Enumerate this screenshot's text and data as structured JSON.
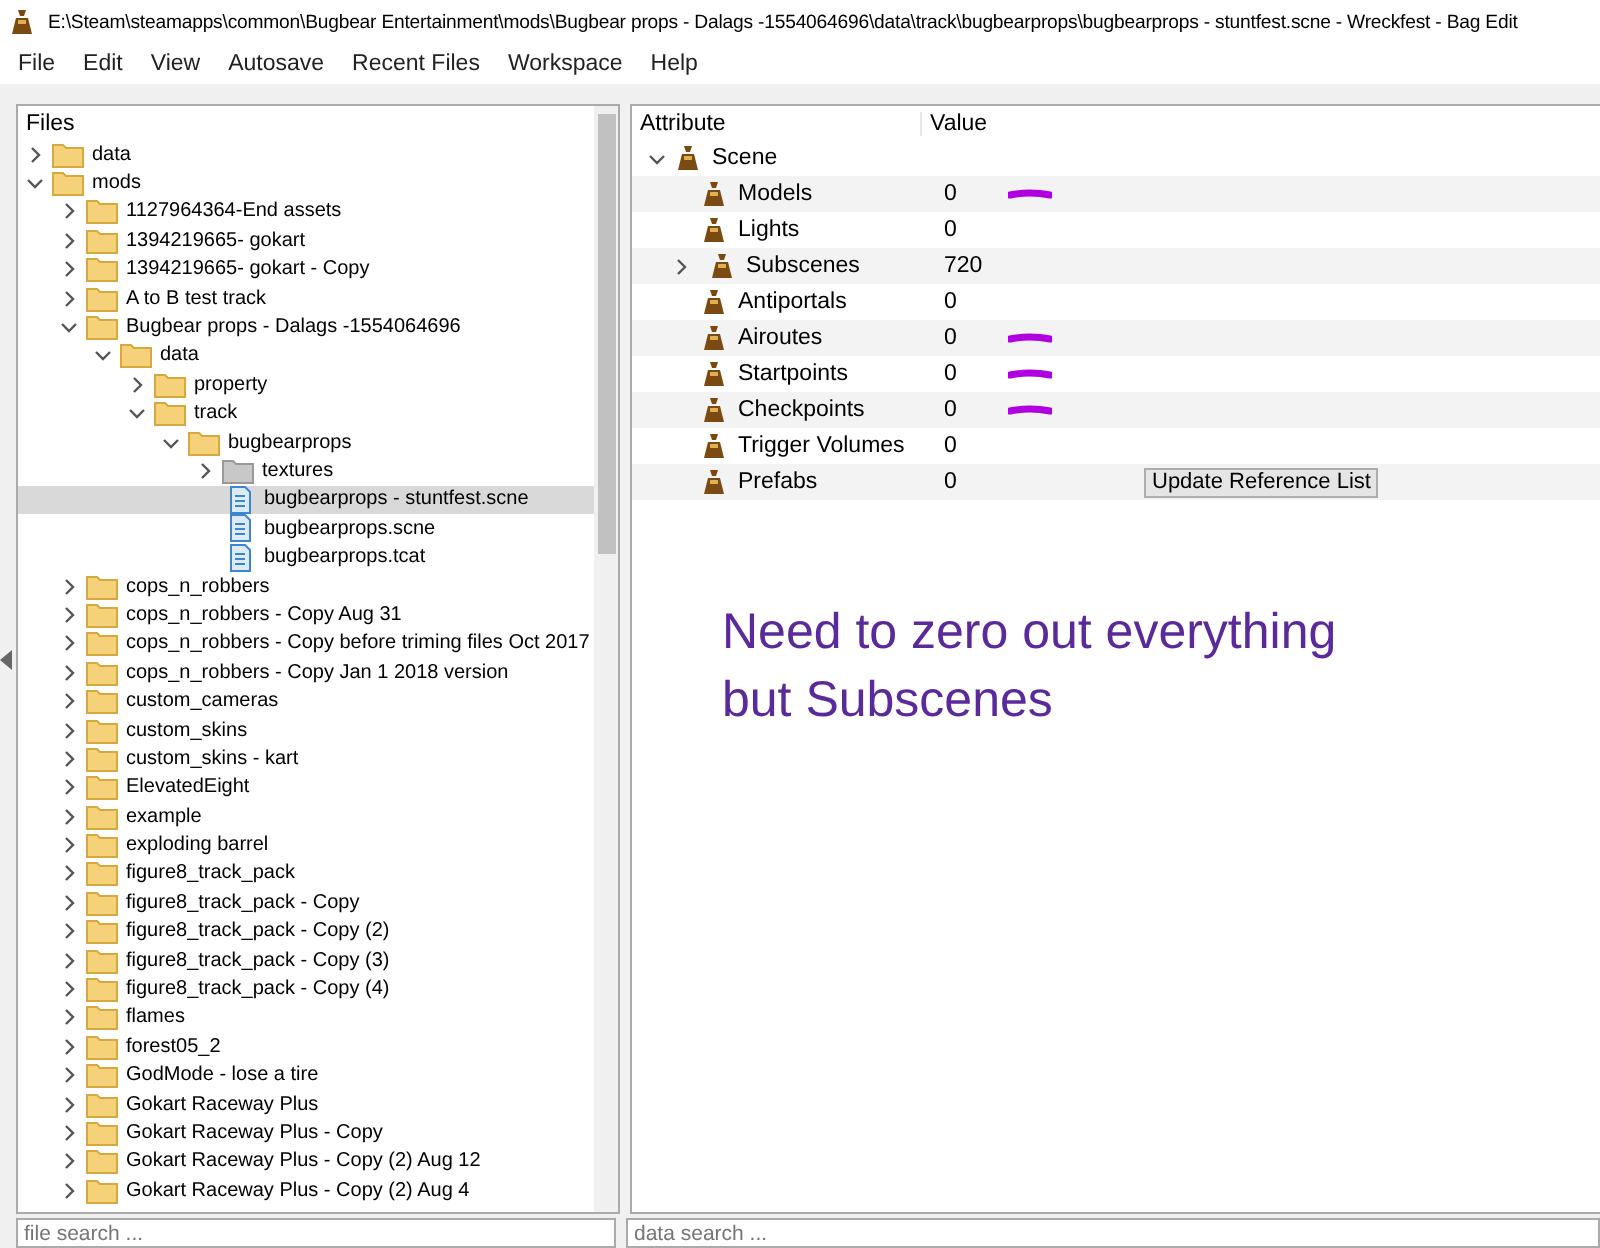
{
  "window": {
    "title": "E:\\Steam\\steamapps\\common\\Bugbear Entertainment\\mods\\Bugbear props - Dalags -1554064696\\data\\track\\bugbearprops\\bugbearprops - stuntfest.scne - Wreckfest - Bag Edit"
  },
  "menu": [
    "File",
    "Edit",
    "View",
    "Autosave",
    "Recent Files",
    "Workspace",
    "Help"
  ],
  "files": {
    "header": "Files",
    "search_placeholder": "file search ...",
    "tree": [
      {
        "name": "data",
        "kind": "folder",
        "expanded": false,
        "selected": false
      },
      {
        "name": "mods",
        "kind": "folder",
        "expanded": true,
        "selected": false,
        "children": [
          {
            "name": "1127964364-End assets",
            "kind": "folder",
            "expanded": false,
            "selected": false
          },
          {
            "name": "1394219665- gokart",
            "kind": "folder",
            "expanded": false,
            "selected": false
          },
          {
            "name": "1394219665- gokart - Copy",
            "kind": "folder",
            "expanded": false,
            "selected": false
          },
          {
            "name": "A to B test track",
            "kind": "folder",
            "expanded": false,
            "selected": false
          },
          {
            "name": "Bugbear props - Dalags -1554064696",
            "kind": "folder",
            "expanded": true,
            "selected": false,
            "children": [
              {
                "name": "data",
                "kind": "folder",
                "expanded": true,
                "selected": false,
                "children": [
                  {
                    "name": "property",
                    "kind": "folder",
                    "expanded": false,
                    "selected": false
                  },
                  {
                    "name": "track",
                    "kind": "folder",
                    "expanded": true,
                    "selected": false,
                    "children": [
                      {
                        "name": "bugbearprops",
                        "kind": "folder",
                        "expanded": true,
                        "selected": false,
                        "children": [
                          {
                            "name": "textures",
                            "kind": "grey-folder",
                            "expanded": false,
                            "selected": false
                          },
                          {
                            "name": "bugbearprops - stuntfest.scne",
                            "kind": "file",
                            "selected": true
                          },
                          {
                            "name": "bugbearprops.scne",
                            "kind": "file",
                            "selected": false
                          },
                          {
                            "name": "bugbearprops.tcat",
                            "kind": "file",
                            "selected": false
                          }
                        ]
                      }
                    ]
                  }
                ]
              }
            ]
          },
          {
            "name": "cops_n_robbers",
            "kind": "folder",
            "expanded": false,
            "selected": false
          },
          {
            "name": "cops_n_robbers - Copy Aug 31",
            "kind": "folder",
            "expanded": false,
            "selected": false
          },
          {
            "name": "cops_n_robbers - Copy before triming files Oct 2017",
            "kind": "folder",
            "expanded": false,
            "selected": false
          },
          {
            "name": "cops_n_robbers - Copy Jan 1 2018 version",
            "kind": "folder",
            "expanded": false,
            "selected": false
          },
          {
            "name": "custom_cameras",
            "kind": "folder",
            "expanded": false,
            "selected": false
          },
          {
            "name": "custom_skins",
            "kind": "folder",
            "expanded": false,
            "selected": false
          },
          {
            "name": "custom_skins - kart",
            "kind": "folder",
            "expanded": false,
            "selected": false
          },
          {
            "name": "ElevatedEight",
            "kind": "folder",
            "expanded": false,
            "selected": false
          },
          {
            "name": "example",
            "kind": "folder",
            "expanded": false,
            "selected": false
          },
          {
            "name": "exploding barrel",
            "kind": "folder",
            "expanded": false,
            "selected": false
          },
          {
            "name": "figure8_track_pack",
            "kind": "folder",
            "expanded": false,
            "selected": false
          },
          {
            "name": "figure8_track_pack - Copy",
            "kind": "folder",
            "expanded": false,
            "selected": false
          },
          {
            "name": "figure8_track_pack - Copy (2)",
            "kind": "folder",
            "expanded": false,
            "selected": false
          },
          {
            "name": "figure8_track_pack - Copy (3)",
            "kind": "folder",
            "expanded": false,
            "selected": false
          },
          {
            "name": "figure8_track_pack - Copy (4)",
            "kind": "folder",
            "expanded": false,
            "selected": false
          },
          {
            "name": "flames",
            "kind": "folder",
            "expanded": false,
            "selected": false
          },
          {
            "name": "forest05_2",
            "kind": "folder",
            "expanded": false,
            "selected": false
          },
          {
            "name": "GodMode - lose a tire",
            "kind": "folder",
            "expanded": false,
            "selected": false
          },
          {
            "name": "Gokart Raceway Plus",
            "kind": "folder",
            "expanded": false,
            "selected": false
          },
          {
            "name": "Gokart Raceway Plus - Copy",
            "kind": "folder",
            "expanded": false,
            "selected": false
          },
          {
            "name": "Gokart Raceway Plus - Copy (2) Aug 12",
            "kind": "folder",
            "expanded": false,
            "selected": false
          },
          {
            "name": "Gokart Raceway Plus - Copy (2) Aug 4",
            "kind": "folder",
            "expanded": false,
            "selected": false
          }
        ]
      }
    ]
  },
  "attributes": {
    "columns": [
      "Attribute",
      "Value"
    ],
    "search_placeholder": "data search ...",
    "root": {
      "name": "Scene",
      "expanded": true
    },
    "rows": [
      {
        "name": "Models",
        "value": "0",
        "marked": true
      },
      {
        "name": "Lights",
        "value": "0",
        "marked": false
      },
      {
        "name": "Subscenes",
        "value": "720",
        "marked": false,
        "expanded": false
      },
      {
        "name": "Antiportals",
        "value": "0",
        "marked": false
      },
      {
        "name": "Airoutes",
        "value": "0",
        "marked": true
      },
      {
        "name": "Startpoints",
        "value": "0",
        "marked": true
      },
      {
        "name": "Checkpoints",
        "value": "0",
        "marked": true
      },
      {
        "name": "Trigger Volumes",
        "value": "0",
        "marked": false
      },
      {
        "name": "Prefabs",
        "value": "0",
        "marked": false,
        "button": "Update Reference List"
      }
    ],
    "note": "Need to zero out everything but Subscenes"
  }
}
